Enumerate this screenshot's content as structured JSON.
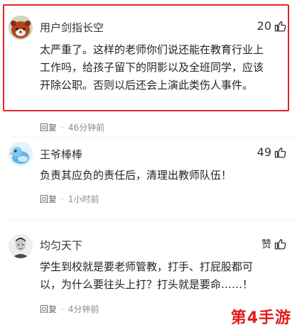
{
  "comments": [
    {
      "username": "用户剑指长空",
      "likes": "20",
      "text_lines": [
        "太严重了。这样的老师你们说还能在教育行业上",
        "工作吗，给孩子留下的阴影以及全班同学，应该",
        "开除公职。否则以后还会上演此类伤人事件。"
      ],
      "reply_label": "回复",
      "time": "46分钟前",
      "avatar_icon": "red-panda-avatar"
    },
    {
      "username": "王爷棒棒",
      "likes": "49",
      "text_lines": [
        "负责其应负的责任后，清理出教师队伍！"
      ],
      "reply_label": "回复",
      "time": "1小时前",
      "avatar_icon": "cartoon-bird-avatar"
    },
    {
      "username": "均匀天下",
      "likes": "赞",
      "text_lines": [
        "学生到校就是要老师管教，打手、打屁股都可",
        "以，为什么要往头上打？打头就是要命……！"
      ],
      "reply_label": "回复",
      "time": "4分钟前",
      "avatar_icon": "man-portrait-avatar"
    }
  ],
  "like_icon": "thumbs-up-icon",
  "highlight_color": "#e02424",
  "watermark": "第4手游"
}
